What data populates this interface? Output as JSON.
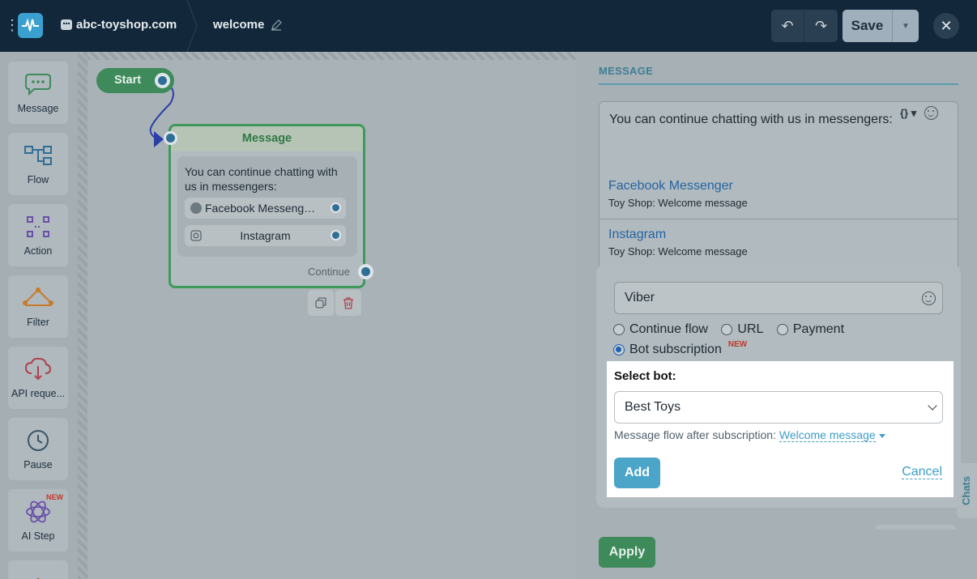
{
  "header": {
    "site": "abc-toyshop.com",
    "flow_name": "welcome",
    "save_label": "Save"
  },
  "palette": {
    "items": [
      {
        "label": "Message",
        "icon": "message-icon"
      },
      {
        "label": "Flow",
        "icon": "flow-icon"
      },
      {
        "label": "Action",
        "icon": "action-icon"
      },
      {
        "label": "Filter",
        "icon": "filter-icon"
      },
      {
        "label": "API reque...",
        "icon": "api-icon"
      },
      {
        "label": "Pause",
        "icon": "clock-icon"
      },
      {
        "label": "AI Step",
        "icon": "ai-icon",
        "badge": "NEW"
      }
    ]
  },
  "canvas": {
    "start_label": "Start",
    "node": {
      "title": "Message",
      "text": "You can continue chatting with us in messengers:",
      "buttons": [
        {
          "label": "Facebook Messeng…",
          "icon": "messenger-icon"
        },
        {
          "label": "Instagram",
          "icon": "instagram-icon"
        }
      ],
      "continue_label": "Continue"
    }
  },
  "panel": {
    "title": "MESSAGE",
    "message_text": "You can continue chatting with us in messengers:",
    "var_button": "{}",
    "buttons": [
      {
        "title": "Facebook Messenger",
        "subtitle": "Toy Shop: Welcome message"
      },
      {
        "title": "Instagram",
        "subtitle": "Toy Shop: Welcome message"
      }
    ],
    "editor": {
      "button_name": "Viber",
      "options": [
        {
          "label": "Continue flow",
          "selected": false
        },
        {
          "label": "URL",
          "selected": false
        },
        {
          "label": "Payment",
          "selected": false
        },
        {
          "label": "Bot subscription",
          "selected": true,
          "badge": "NEW"
        }
      ],
      "select_bot_label": "Select bot:",
      "selected_bot": "Best Toys",
      "after_label": "Message flow after subscription:",
      "after_value": "Welcome message",
      "add_label": "Add",
      "cancel_label": "Cancel"
    },
    "apply_label": "Apply",
    "chats_tab": "Chats"
  },
  "colors": {
    "topbar": "#12283a",
    "accent": "#3e8a5a",
    "link": "#3d9dc8"
  }
}
